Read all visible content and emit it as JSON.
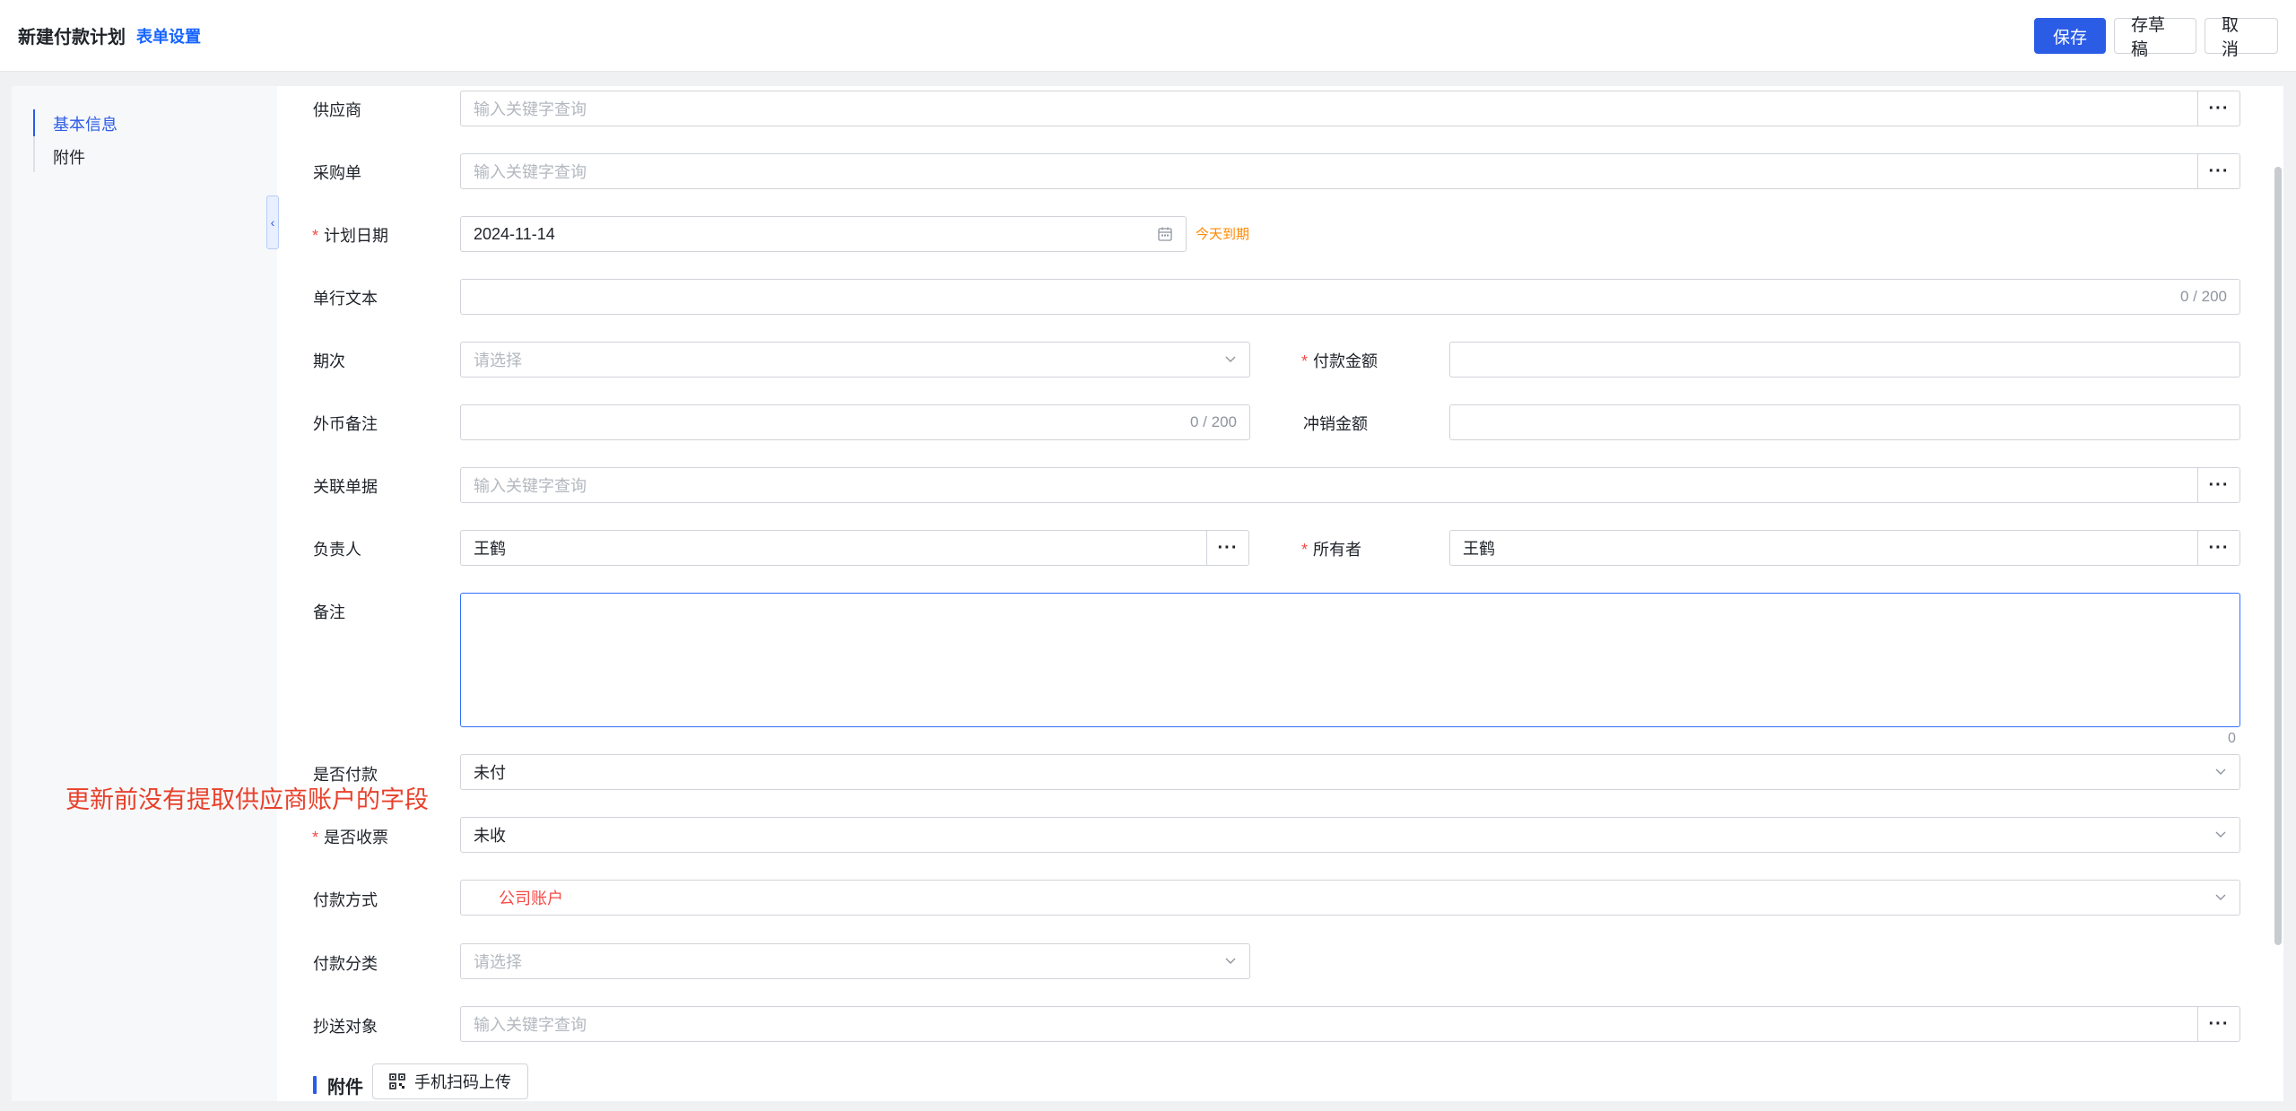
{
  "header": {
    "title": "新建付款计划",
    "form_settings": "表单设置",
    "save": "保存",
    "draft": "存草稿",
    "cancel": "取消"
  },
  "sidebar": {
    "items": [
      {
        "label": "基本信息",
        "active": true
      },
      {
        "label": "附件",
        "active": false
      }
    ]
  },
  "annotation": "更新前没有提取供应商账户的字段",
  "form": {
    "supplier": {
      "label": "供应商",
      "placeholder": "输入关键字查询"
    },
    "purchase_order": {
      "label": "采购单",
      "placeholder": "输入关键字查询"
    },
    "plan_date": {
      "label": "计划日期",
      "value": "2024-11-14",
      "hint": "今天到期"
    },
    "single_text": {
      "label": "单行文本",
      "counter": "0 / 200"
    },
    "period": {
      "label": "期次",
      "placeholder": "请选择"
    },
    "pay_amount": {
      "label": "付款金额",
      "value": ""
    },
    "fx_note": {
      "label": "外币备注",
      "counter": "0 / 200"
    },
    "writeoff_amount": {
      "label": "冲销金额",
      "value": ""
    },
    "related_doc": {
      "label": "关联单据",
      "placeholder": "输入关键字查询"
    },
    "owner_person": {
      "label": "负责人",
      "value": "王鹤"
    },
    "owner": {
      "label": "所有者",
      "value": "王鹤"
    },
    "remark": {
      "label": "备注",
      "counter": "0"
    },
    "is_paid": {
      "label": "是否付款",
      "value": "未付"
    },
    "is_invoiced": {
      "label": "是否收票",
      "value": "未收"
    },
    "pay_method": {
      "label": "付款方式",
      "value": "公司账户"
    },
    "pay_category": {
      "label": "付款分类",
      "placeholder": "请选择"
    },
    "cc": {
      "label": "抄送对象",
      "placeholder": "输入关键字查询"
    }
  },
  "attachments": {
    "title": "附件",
    "scan_upload": "手机扫码上传"
  },
  "colors": {
    "primary": "#2b5ce6",
    "required": "#f54a45",
    "annotation": "#e8412b",
    "hint": "#ff8800"
  }
}
